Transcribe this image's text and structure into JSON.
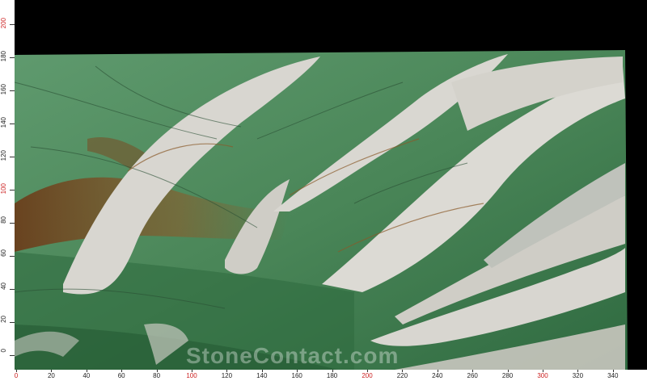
{
  "image": {
    "subject": "marble-slab",
    "palette": {
      "green": "#4f8a5c",
      "dark_green": "#2f5f3c",
      "white_vein": "#d8d6d0",
      "rust": "#7a4a22",
      "background": "#000000"
    }
  },
  "ruler_left": {
    "labels": [
      "200",
      "180",
      "160",
      "140",
      "120",
      "100",
      "80",
      "60",
      "40",
      "20",
      "0"
    ],
    "accent_labels": [
      "200",
      "100"
    ],
    "accent_color": "#cc2222",
    "normal_color": "#222222"
  },
  "ruler_bottom": {
    "labels": [
      "0",
      "20",
      "40",
      "60",
      "80",
      "100",
      "120",
      "140",
      "160",
      "180",
      "200",
      "220",
      "240",
      "260",
      "280",
      "300",
      "320",
      "340"
    ],
    "accent_labels": [
      "0",
      "100",
      "200",
      "300"
    ],
    "accent_color": "#cc2222",
    "normal_color": "#222222"
  },
  "watermark": {
    "text": "StoneContact.com"
  }
}
